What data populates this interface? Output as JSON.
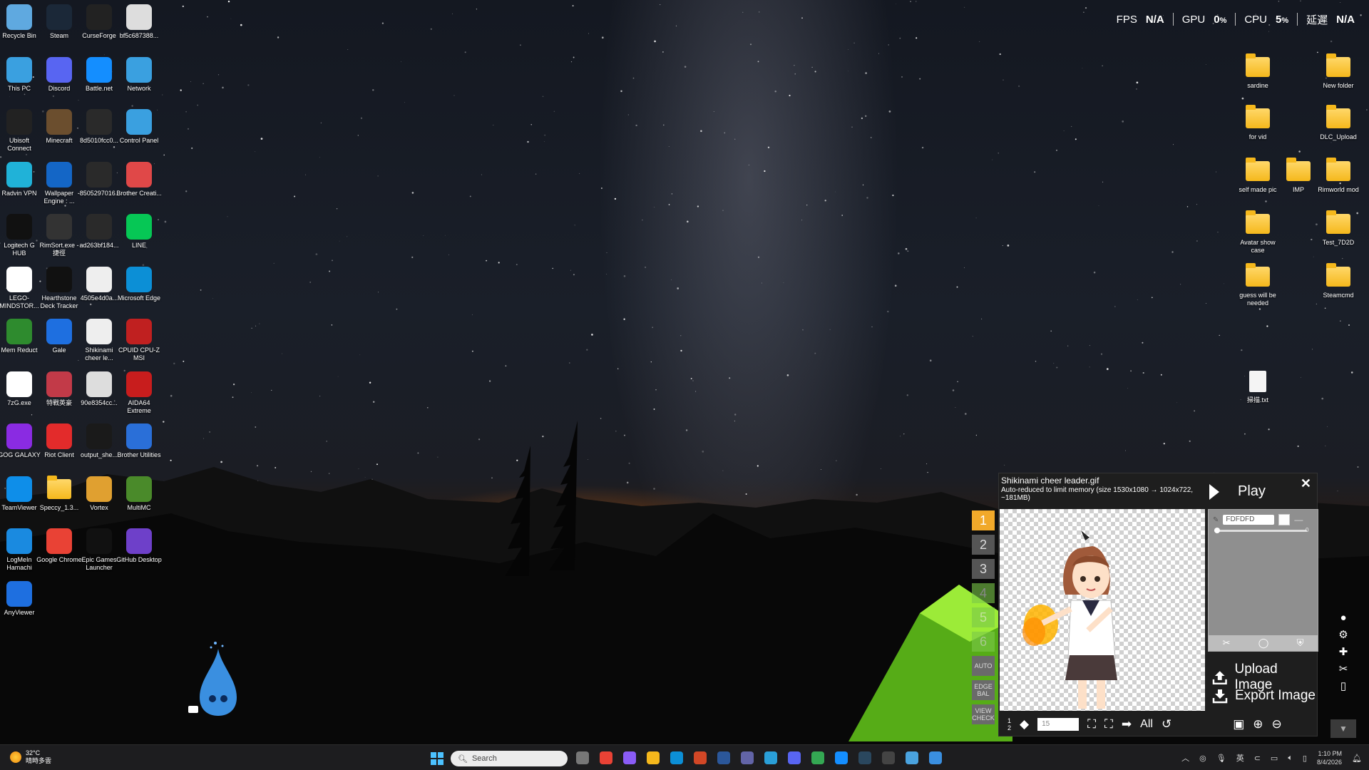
{
  "desktop_icons": [
    {
      "label": "Recycle Bin",
      "icon": "recycle-bin-icon",
      "color": "#5fa9e0"
    },
    {
      "label": "Steam",
      "icon": "steam-icon",
      "color": "#1b2838"
    },
    {
      "label": "CurseForge",
      "icon": "curseforge-icon",
      "color": "#222222"
    },
    {
      "label": "bf5c687388...",
      "icon": "image-file-icon",
      "color": "#dddddd"
    },
    {
      "label": "This PC",
      "icon": "monitor-icon",
      "color": "#3aa0e0"
    },
    {
      "label": "Discord",
      "icon": "discord-icon",
      "color": "#5865f2"
    },
    {
      "label": "Battle.net",
      "icon": "battlenet-icon",
      "color": "#148eff"
    },
    {
      "label": "Network",
      "icon": "network-icon",
      "color": "#3aa0e0"
    },
    {
      "label": "Ubisoft Connect",
      "icon": "ubisoft-icon",
      "color": "#222222"
    },
    {
      "label": "Minecraft",
      "icon": "minecraft-icon",
      "color": "#6b4e2e"
    },
    {
      "label": "8d5010fcc0...",
      "icon": "image-file-icon",
      "color": "#2a2a2a"
    },
    {
      "label": "Control Panel",
      "icon": "control-panel-icon",
      "color": "#3aa0e0"
    },
    {
      "label": "Radvin VPN",
      "icon": "vpn-shield-icon",
      "color": "#20b2d8"
    },
    {
      "label": "Wallpaper Engine : ...",
      "icon": "wallpaper-engine-icon",
      "color": "#1466c6"
    },
    {
      "label": "-8505297016...",
      "icon": "image-file-icon",
      "color": "#2a2a2a"
    },
    {
      "label": "Brother Creati...",
      "icon": "brother-icon",
      "color": "#e04848"
    },
    {
      "label": "Logitech G HUB",
      "icon": "logitech-icon",
      "color": "#111111"
    },
    {
      "label": "RimSort.exe - 捷徑",
      "icon": "rimsort-icon",
      "color": "#333333"
    },
    {
      "label": "ad263bf184...",
      "icon": "image-file-icon",
      "color": "#2a2a2a"
    },
    {
      "label": "LINE",
      "icon": "line-icon",
      "color": "#06c755"
    },
    {
      "label": "LEGO-MINDSTOR...",
      "icon": "lego-icon",
      "color": "#ffffff"
    },
    {
      "label": "Hearthstone Deck Tracker",
      "icon": "hearthstone-icon",
      "color": "#111111"
    },
    {
      "label": "4505e4d0a...",
      "icon": "image-file-icon",
      "color": "#eeeeee"
    },
    {
      "label": "Microsoft Edge",
      "icon": "edge-icon",
      "color": "#0c8fd6"
    },
    {
      "label": "Mem Reduct",
      "icon": "memreduct-icon",
      "color": "#2e8b2e"
    },
    {
      "label": "Gale",
      "icon": "gale-icon",
      "color": "#1e6fe0"
    },
    {
      "label": "Shikinami cheer le...",
      "icon": "image-file-icon",
      "color": "#eeeeee"
    },
    {
      "label": "CPUID CPU-Z MSI",
      "icon": "cpuz-icon",
      "color": "#c02020"
    },
    {
      "label": "7zG.exe",
      "icon": "7zip-icon",
      "color": "#ffffff"
    },
    {
      "label": "特戰英豪",
      "icon": "valorant-icon",
      "color": "#c23a48"
    },
    {
      "label": "90e8354cc...",
      "icon": "image-file-icon",
      "color": "#dddddd"
    },
    {
      "label": "AIDA64 Extreme",
      "icon": "aida64-icon",
      "color": "#c81d1d"
    },
    {
      "label": "GOG GALAXY",
      "icon": "gog-icon",
      "color": "#8a2be2"
    },
    {
      "label": "Riot Client",
      "icon": "riot-icon",
      "color": "#e32b2b"
    },
    {
      "label": "output_she...",
      "icon": "image-file-icon",
      "color": "#1a1a1a"
    },
    {
      "label": "Brother Utilities",
      "icon": "brother-utilities-icon",
      "color": "#2a6fd8"
    },
    {
      "label": "TeamViewer",
      "icon": "teamviewer-icon",
      "color": "#0e8ee9"
    },
    {
      "label": "Speccy_1.3...",
      "icon": "folder-icon",
      "color": "#f5b81c"
    },
    {
      "label": "Vortex",
      "icon": "vortex-icon",
      "color": "#e0a030"
    },
    {
      "label": "MultiMC",
      "icon": "multimc-icon",
      "color": "#4a8a2a"
    },
    {
      "label": "LogMeIn Hamachi",
      "icon": "hamachi-icon",
      "color": "#1a8ae0"
    },
    {
      "label": "Google Chrome",
      "icon": "chrome-icon",
      "color": "#e94235"
    },
    {
      "label": "Epic Games Launcher",
      "icon": "epic-games-icon",
      "color": "#111111"
    },
    {
      "label": "GitHub Desktop",
      "icon": "github-icon",
      "color": "#6e40c9"
    },
    {
      "label": "AnyViewer",
      "icon": "anyviewer-icon",
      "color": "#1e6fe0"
    }
  ],
  "right_icons": [
    {
      "label": "sardine"
    },
    {
      "label": "New folder"
    },
    {
      "label": "for vid"
    },
    {
      "label": "DLC_Upload"
    },
    {
      "label": "self made pic"
    },
    {
      "label": "IMP"
    },
    {
      "label": "Rimworld mod"
    },
    {
      "label": "Avatar show case"
    },
    {
      "label": "Test_7D2D"
    },
    {
      "label": "guess will be needed"
    },
    {
      "label": "Steamcmd"
    },
    {
      "label": "掃描.txt"
    }
  ],
  "hud": {
    "fps_label": "FPS",
    "fps_value": "N/A",
    "gpu_label": "GPU",
    "gpu_value": "0",
    "cpu_label": "CPU",
    "cpu_value": "5",
    "pct": "%",
    "latency_label": "延遲",
    "latency_value": "N/A"
  },
  "gif_panel": {
    "title": "Shikinami cheer leader.gif",
    "subtitle": "Auto-reduced to limit memory (size 1530x1080 → 1024x722, ~181MB)",
    "play_label": "Play",
    "color_value": "FDFDFD",
    "slider_value": "0",
    "upload_label": "Upload Image",
    "export_label": "Export Image",
    "frame_count_top": "1",
    "frame_count_bottom": "2",
    "frame_input": "15",
    "all_label": "All"
  },
  "frame_tabs": [
    "1",
    "2",
    "3",
    "4",
    "5",
    "6",
    "AUTO",
    "EDGE BAL",
    "VIEW CHECK"
  ],
  "taskbar": {
    "weather_temp": "32°C",
    "weather_desc": "晴時多雲",
    "search_placeholder": "Search",
    "ime_label": "英",
    "time": "1:10 PM",
    "date": "8/4/2026"
  },
  "colors": {
    "accent_orange": "#f1a92a",
    "panel_bg": "#1e1e1e",
    "taskbar_bg": "#1d1d1f",
    "start_blue": "#4cc2ff"
  }
}
